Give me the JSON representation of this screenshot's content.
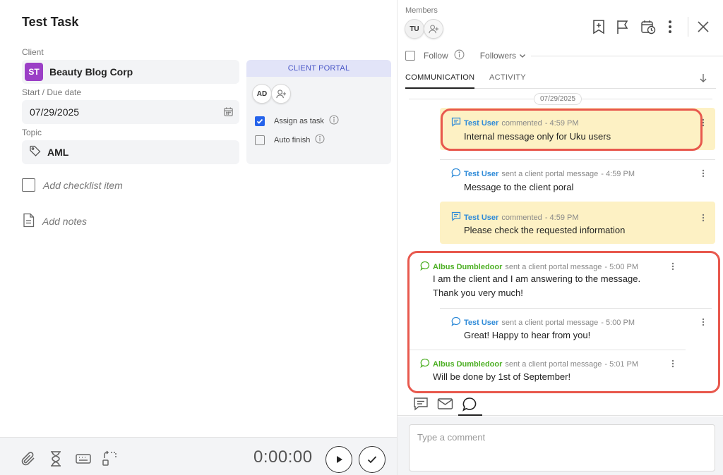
{
  "task": {
    "title": "Test Task"
  },
  "client": {
    "label": "Client",
    "initials": "ST",
    "name": "Beauty Blog Corp",
    "badge_color": "#9b3fc6"
  },
  "dates": {
    "label": "Start / Due date",
    "value": "07/29/2025"
  },
  "topic": {
    "label": "Topic",
    "value": "AML"
  },
  "checklist": {
    "placeholder": "Add checklist item"
  },
  "notes": {
    "placeholder": "Add notes"
  },
  "client_portal": {
    "title": "CLIENT PORTAL",
    "avatar_initials": "AD",
    "assign_as_task": {
      "label": "Assign as task",
      "checked": true
    },
    "auto_finish": {
      "label": "Auto finish",
      "checked": false
    }
  },
  "timer": {
    "value": "0:00:00"
  },
  "members": {
    "label": "Members",
    "avatar_initials": "TU"
  },
  "follow": {
    "label": "Follow",
    "followers_label": "Followers"
  },
  "tabs": {
    "communication": "COMMUNICATION",
    "activity": "ACTIVITY"
  },
  "feed": {
    "date": "07/29/2025",
    "messages": [
      {
        "author": "Test User",
        "action": "commented",
        "time": "- 4:59 PM",
        "text": "Internal message only for Uku users",
        "kind": "note"
      },
      {
        "author": "Test User",
        "action": "sent a client portal message",
        "time": "- 4:59 PM",
        "text": "Message to the client poral",
        "kind": "portal"
      },
      {
        "author": "Test User",
        "action": "commented",
        "time": "- 4:59 PM",
        "text": "Please check the requested information",
        "kind": "note"
      },
      {
        "author": "Albus Dumbledoor",
        "action": "sent a client portal message",
        "time": "- 5:00 PM",
        "text_line1": "I am the client and I am answering to the message.",
        "text_line2": "Thank you very much!",
        "kind": "client"
      },
      {
        "author": "Test User",
        "action": "sent a client portal message",
        "time": "- 5:00 PM",
        "text": "Great! Happy to hear from you!",
        "kind": "portal"
      },
      {
        "author": "Albus Dumbledoor",
        "action": "sent a client portal message",
        "time": "- 5:01 PM",
        "text": "Will be done by 1st of September!",
        "kind": "client"
      }
    ]
  },
  "compose": {
    "placeholder": "Type a comment"
  },
  "colors": {
    "accent_blue": "#2f8bd8",
    "client_green": "#4caf23",
    "note_yellow": "#fdf1c4",
    "highlight_red": "#e8584d",
    "checkbox_blue": "#2563eb"
  }
}
